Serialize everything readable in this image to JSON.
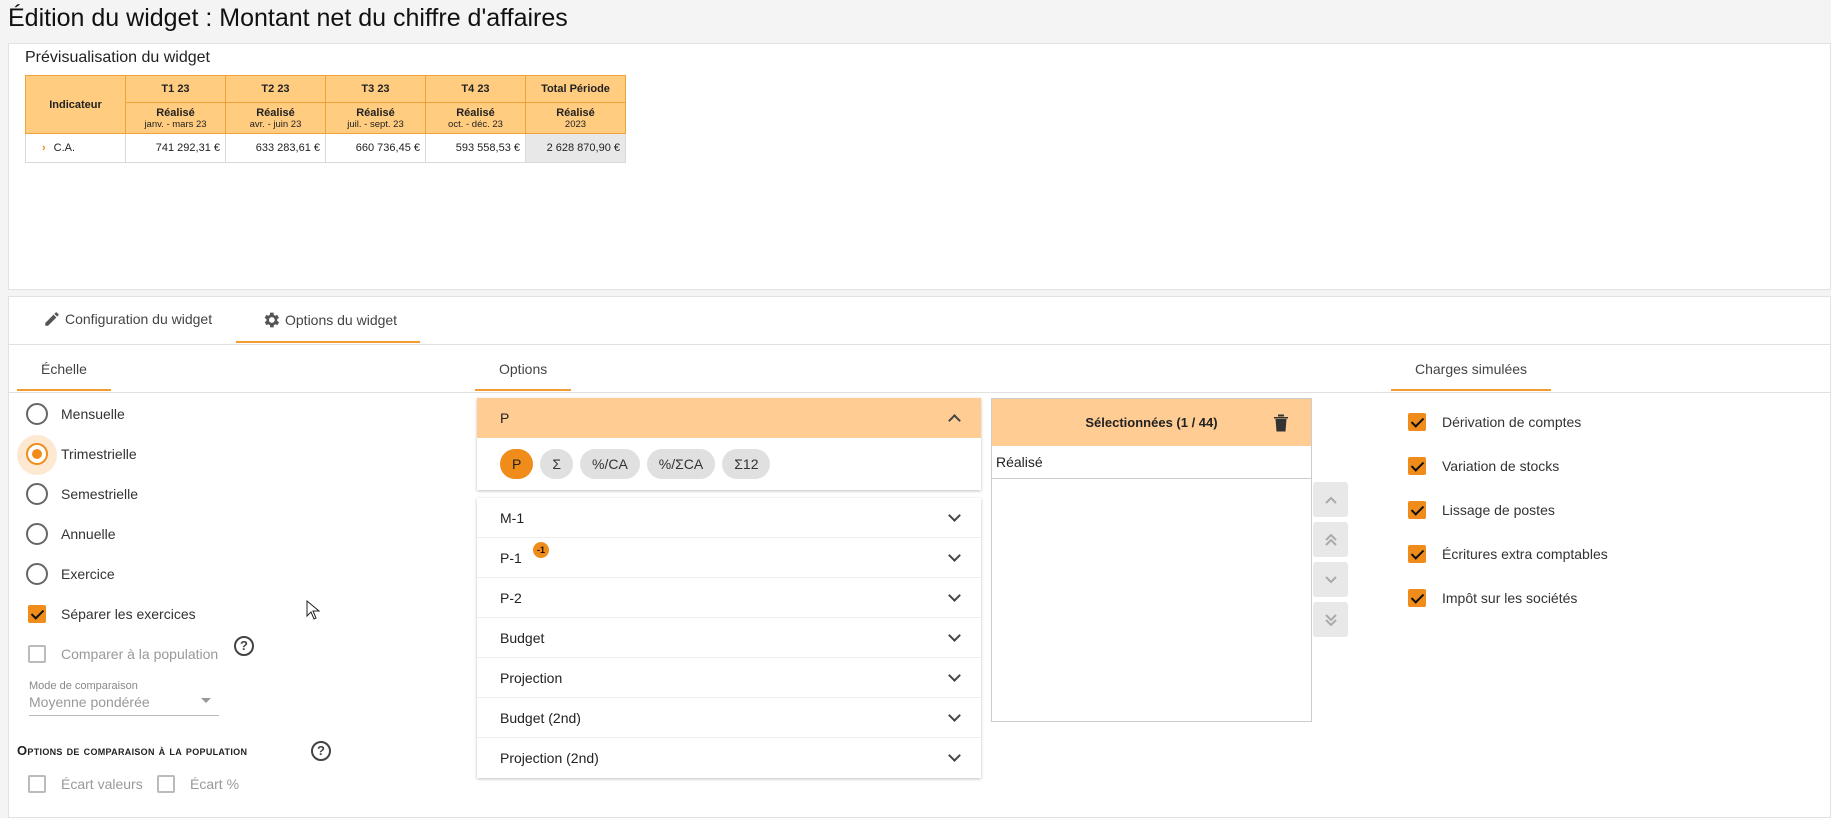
{
  "page": {
    "title": "Édition du widget : Montant net du chiffre d'affaires"
  },
  "preview": {
    "title": "Prévisualisation du widget",
    "indicator_header": "Indicateur",
    "columns": [
      {
        "name": "T1 23",
        "type": "Réalisé",
        "range": "janv. - mars 23"
      },
      {
        "name": "T2 23",
        "type": "Réalisé",
        "range": "avr. - juin 23"
      },
      {
        "name": "T3 23",
        "type": "Réalisé",
        "range": "juil. - sept. 23"
      },
      {
        "name": "T4 23",
        "type": "Réalisé",
        "range": "oct. - déc. 23"
      },
      {
        "name": "Total Période",
        "type": "Réalisé",
        "range": "2023"
      }
    ],
    "row": {
      "label": "C.A.",
      "values": [
        "741 292,31 €",
        "633 283,61 €",
        "660 736,45 €",
        "593 558,53 €",
        "2 628 870,90 €"
      ]
    }
  },
  "tabs": {
    "config": "Configuration du widget",
    "options": "Options du widget"
  },
  "scale": {
    "title": "Échelle",
    "options": [
      "Mensuelle",
      "Trimestrielle",
      "Semestrielle",
      "Annuelle",
      "Exercice"
    ],
    "selected": "Trimestrielle",
    "separate": "Séparer les exercices",
    "compare": "Comparer à la population",
    "mode_label": "Mode de comparaison",
    "mode_value": "Moyenne pondérée",
    "comp_title": "Options de comparaison à la population",
    "ecart_valeurs": "Écart valeurs",
    "ecart_pct": "Écart %"
  },
  "options": {
    "title": "Options",
    "open_item": "P",
    "chips": [
      "P",
      "Σ",
      "%/CA",
      "%/ΣCA",
      "Σ12"
    ],
    "items": [
      "M-1",
      "P-1",
      "P-2",
      "Budget",
      "Projection",
      "Budget (2nd)",
      "Projection (2nd)"
    ],
    "p1_badge": "-1"
  },
  "selected": {
    "title": "Sélectionnées (1 / 44)",
    "items": [
      "Réalisé"
    ]
  },
  "charges": {
    "title": "Charges simulées",
    "items": [
      "Dérivation de comptes",
      "Variation de stocks",
      "Lissage de postes",
      "Écritures extra comptables",
      "Impôt sur les sociétés"
    ]
  }
}
